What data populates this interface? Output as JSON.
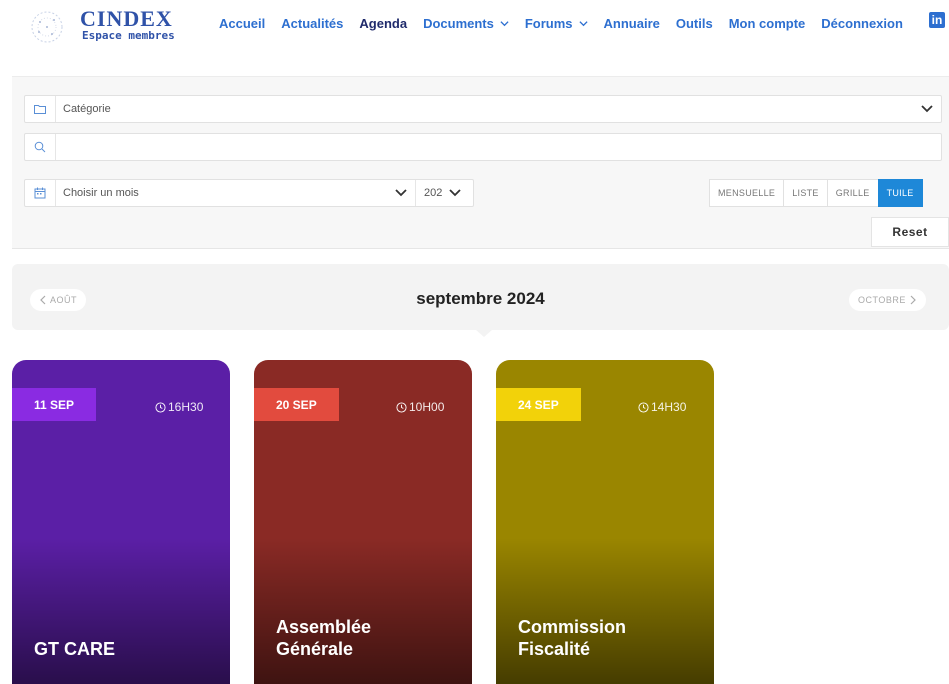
{
  "brand": {
    "title": "CINDEX",
    "subtitle": "Espace membres"
  },
  "nav": {
    "items": [
      {
        "label": "Accueil"
      },
      {
        "label": "Actualités"
      },
      {
        "label": "Agenda",
        "active": true
      },
      {
        "label": "Documents",
        "dropdown": true
      },
      {
        "label": "Forums",
        "dropdown": true
      },
      {
        "label": "Annuaire"
      },
      {
        "label": "Outils"
      },
      {
        "label": "Mon compte"
      },
      {
        "label": "Déconnexion"
      }
    ],
    "social": "in"
  },
  "filters": {
    "category_placeholder": "Catégorie",
    "search_value": "",
    "month_placeholder": "Choisir un mois",
    "year_value": "202",
    "views": [
      {
        "label": "MENSUELLE"
      },
      {
        "label": "LISTE"
      },
      {
        "label": "GRILLE"
      },
      {
        "label": "TUILE",
        "active": true
      }
    ],
    "reset_label": "Reset"
  },
  "month_nav": {
    "prev_label": "AOÛT",
    "current": "septembre 2024",
    "next_label": "OCTOBRE"
  },
  "events": [
    {
      "date": "11 SEP",
      "time": "16H30",
      "title_line1": "GT CARE",
      "title_line2": "",
      "color": "#5b1fa6",
      "badge_color": "#8a2be2"
    },
    {
      "date": "20 SEP",
      "time": "10H00",
      "title_line1": "Assemblée",
      "title_line2": "Générale",
      "color": "#8a2a25",
      "badge_color": "#e24b3e"
    },
    {
      "date": "24 SEP",
      "time": "14H30",
      "title_line1": "Commission",
      "title_line2": "Fiscalité",
      "color": "#9a8600",
      "badge_color": "#f2d20a"
    }
  ],
  "icons": {
    "folder": "folder-icon",
    "search": "search-icon",
    "calendar": "calendar-icon",
    "clock": "clock-icon",
    "chevron": "chevron-down-icon"
  }
}
